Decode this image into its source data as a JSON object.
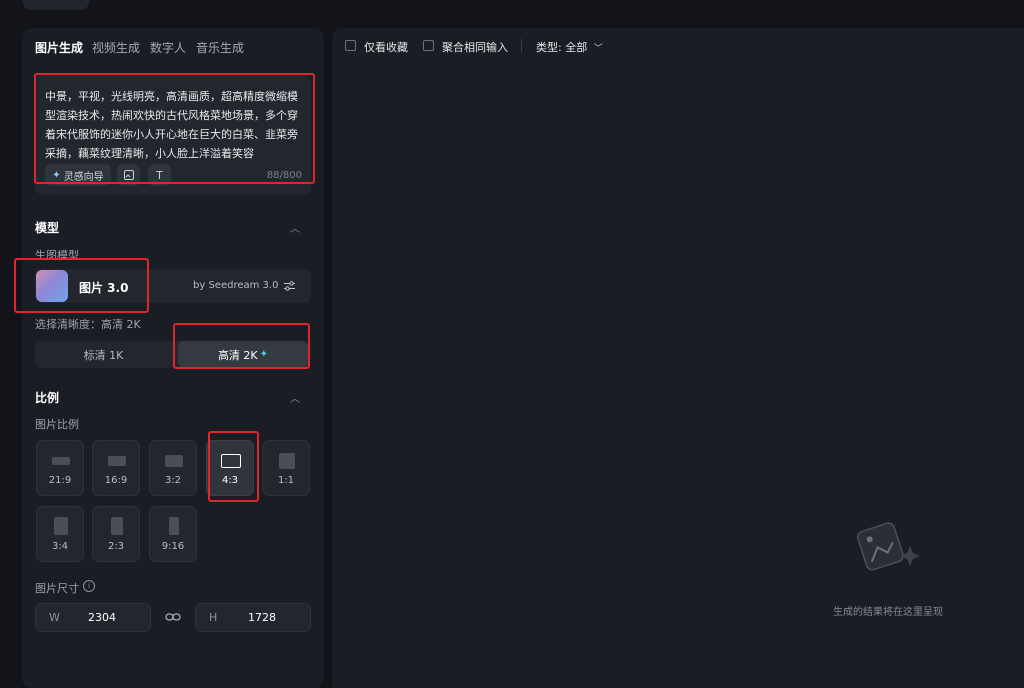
{
  "tabs": [
    {
      "label": "图片生成",
      "active": true
    },
    {
      "label": "视频生成",
      "active": false
    },
    {
      "label": "数字人",
      "active": false
    },
    {
      "label": "音乐生成",
      "active": false
    }
  ],
  "prompt": {
    "text": "中景，平视，光线明亮，高清画质，超高精度微缩模型渲染技术，热闹欢快的古代风格菜地场景，多个穿着宋代服饰的迷你小人开心地在巨大的白菜、韭菜旁采摘，藕菜纹理清晰，小人脸上洋溢着笑容",
    "inspiration_label": "灵感向导",
    "counter": "88/800"
  },
  "model_section": {
    "title": "模型",
    "model_label": "生图模型",
    "model_name": "图片 3.0",
    "model_by": "by Seedream 3.0",
    "clarity_label": "选择清晰度：高清 2K",
    "clarity_options": [
      {
        "label": "标清 1K",
        "selected": false
      },
      {
        "label": "高清 2K",
        "selected": true
      }
    ]
  },
  "ratio_section": {
    "title": "比例",
    "ratio_label": "图片比例",
    "ratios": [
      {
        "label": "21:9",
        "selected": false
      },
      {
        "label": "16:9",
        "selected": false
      },
      {
        "label": "3:2",
        "selected": false
      },
      {
        "label": "4:3",
        "selected": true
      },
      {
        "label": "1:1",
        "selected": false
      },
      {
        "label": "3:4",
        "selected": false
      },
      {
        "label": "2:3",
        "selected": false
      },
      {
        "label": "9:16",
        "selected": false
      }
    ],
    "size_label": "图片尺寸",
    "width_key": "W",
    "width_value": "2304",
    "height_key": "H",
    "height_value": "1728"
  },
  "toolbar": {
    "favorites_label": "仅看收藏",
    "merge_label": "聚合相同输入",
    "type_label": "类型: 全部"
  },
  "empty_state": {
    "text": "生成的结果将在这里呈现"
  },
  "colors": {
    "highlight": "#e0262c",
    "accent_star": "#3fd6e6"
  }
}
